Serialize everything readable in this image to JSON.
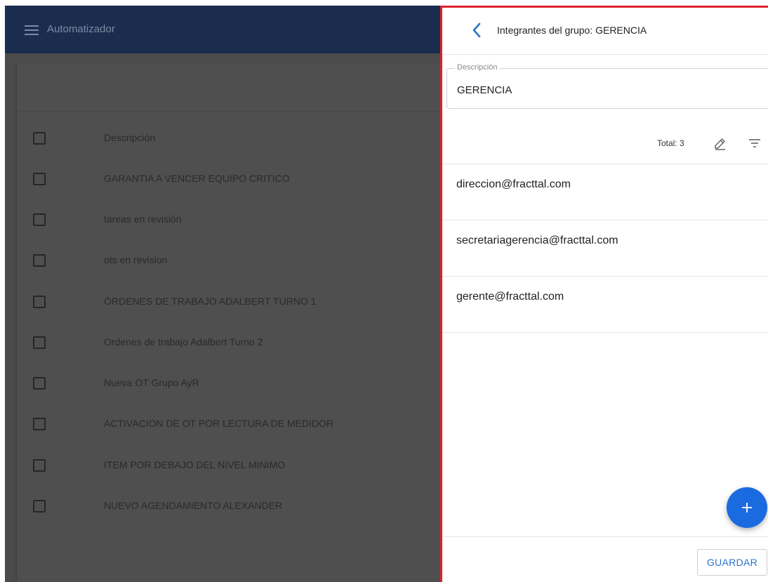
{
  "app": {
    "title": "Automatizador"
  },
  "list": {
    "header": "Descripción",
    "rows": [
      "GARANTIA A VENCER EQUIPO CRITICO",
      "tareas en revisiòn",
      "ots en revision",
      "ÓRDENES DE TRABAJO ADALBERT TURNO 1",
      "Ordenes de trabajo Adalbert Turno 2",
      "Nueva OT Grupo AyR",
      "ACTIVACION DE OT POR LECTURA DE MEDIDOR",
      "ITEM POR DEBAJO DEL NIVEL MINIMO",
      "NUEVO AGENDAMIENTO ALEXANDER"
    ]
  },
  "panel": {
    "title": "Integrantes del grupo: GERENCIA",
    "description_label": "Descripción",
    "description_value": "GERENCIA",
    "total": "Total: 3",
    "members": [
      "direccion@fracttal.com",
      "secretariagerencia@fracttal.com",
      "gerente@fracttal.com"
    ],
    "save_label": "GUARDAR"
  },
  "colors": {
    "accent": "#1b6be0",
    "appbar": "#1b2d4f",
    "highlight_border": "#e0222e",
    "save_text": "#2b73c9"
  },
  "icons": [
    "menu-icon",
    "back-icon",
    "edit-icon",
    "filter-icon",
    "plus-icon"
  ]
}
